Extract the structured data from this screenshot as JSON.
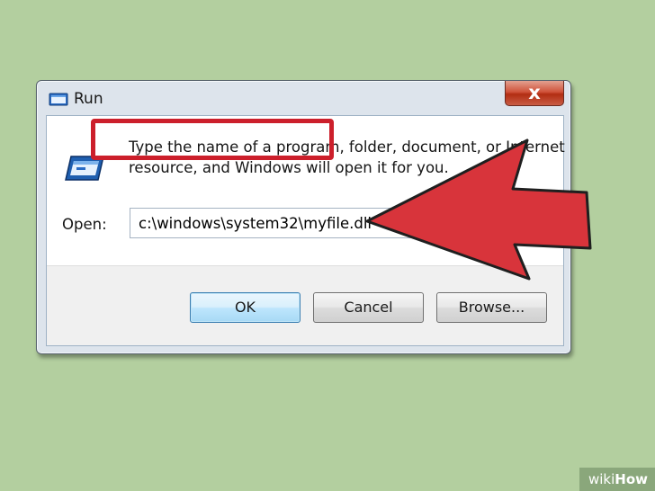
{
  "window": {
    "title": "Run",
    "close_glyph": "x",
    "title_icon": "run-icon"
  },
  "dialog": {
    "app_icon": "run-window-icon",
    "description": "Type the name of a program, folder, document, or Internet\nresource, and Windows will open it for you.",
    "open_label": "Open:",
    "open_value": "c:\\windows\\system32\\myfile.dll"
  },
  "buttons": {
    "ok": "OK",
    "cancel": "Cancel",
    "browse": "Browse..."
  },
  "annotation": {
    "color": "#cc1f2b",
    "arrow": "red-pointer-arrow"
  },
  "watermark": {
    "part1": "wiki",
    "part2": "How"
  },
  "colors": {
    "background": "#b3cf9f",
    "close_button": "#c8442b",
    "ok_button_border": "#3c7fb1"
  }
}
